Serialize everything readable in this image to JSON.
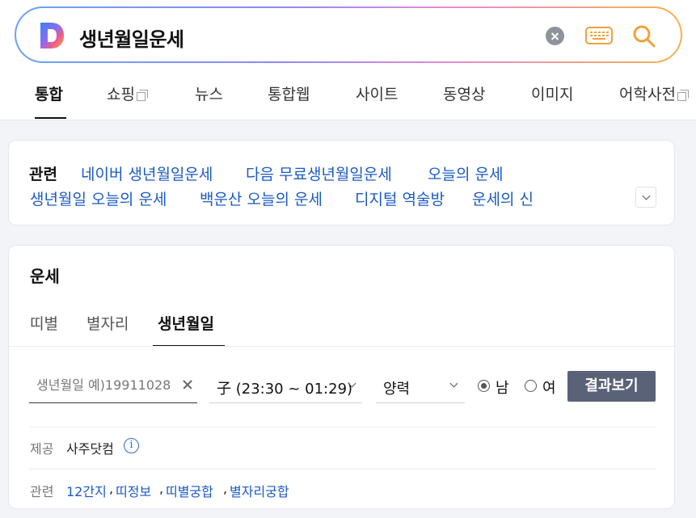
{
  "search": {
    "query": "생년월일운세",
    "logo_letter": "D"
  },
  "tabs": [
    {
      "label": "통합",
      "active": true
    },
    {
      "label": "쇼핑",
      "external": true
    },
    {
      "label": "뉴스"
    },
    {
      "label": "통합웹"
    },
    {
      "label": "사이트"
    },
    {
      "label": "동영상"
    },
    {
      "label": "이미지"
    },
    {
      "label": "어학사전",
      "external": true
    }
  ],
  "related": {
    "label": "관련",
    "links": [
      "네이버 생년월일운세",
      "다음 무료생년월일운세",
      "오늘의 운세",
      "생년월일 오늘의 운세",
      "백운산 오늘의 운세",
      "디지털 역술방",
      "운세의 신"
    ]
  },
  "fortune": {
    "title": "운세",
    "tabs": [
      "띠별",
      "별자리",
      "생년월일"
    ],
    "birth_placeholder": "생년월일 예)19911028",
    "time_value": "子 (23:30 ~ 01:29)",
    "calendar_value": "양력",
    "gender": [
      "남",
      "여"
    ],
    "result_button": "결과보기",
    "provider_label": "제공",
    "provider": "사주닷컴",
    "info_glyph": "i",
    "related_label": "관련",
    "related_links": [
      "12간지",
      "띠정보",
      "띠별궁합",
      "별자리궁합"
    ],
    "separator": ","
  }
}
